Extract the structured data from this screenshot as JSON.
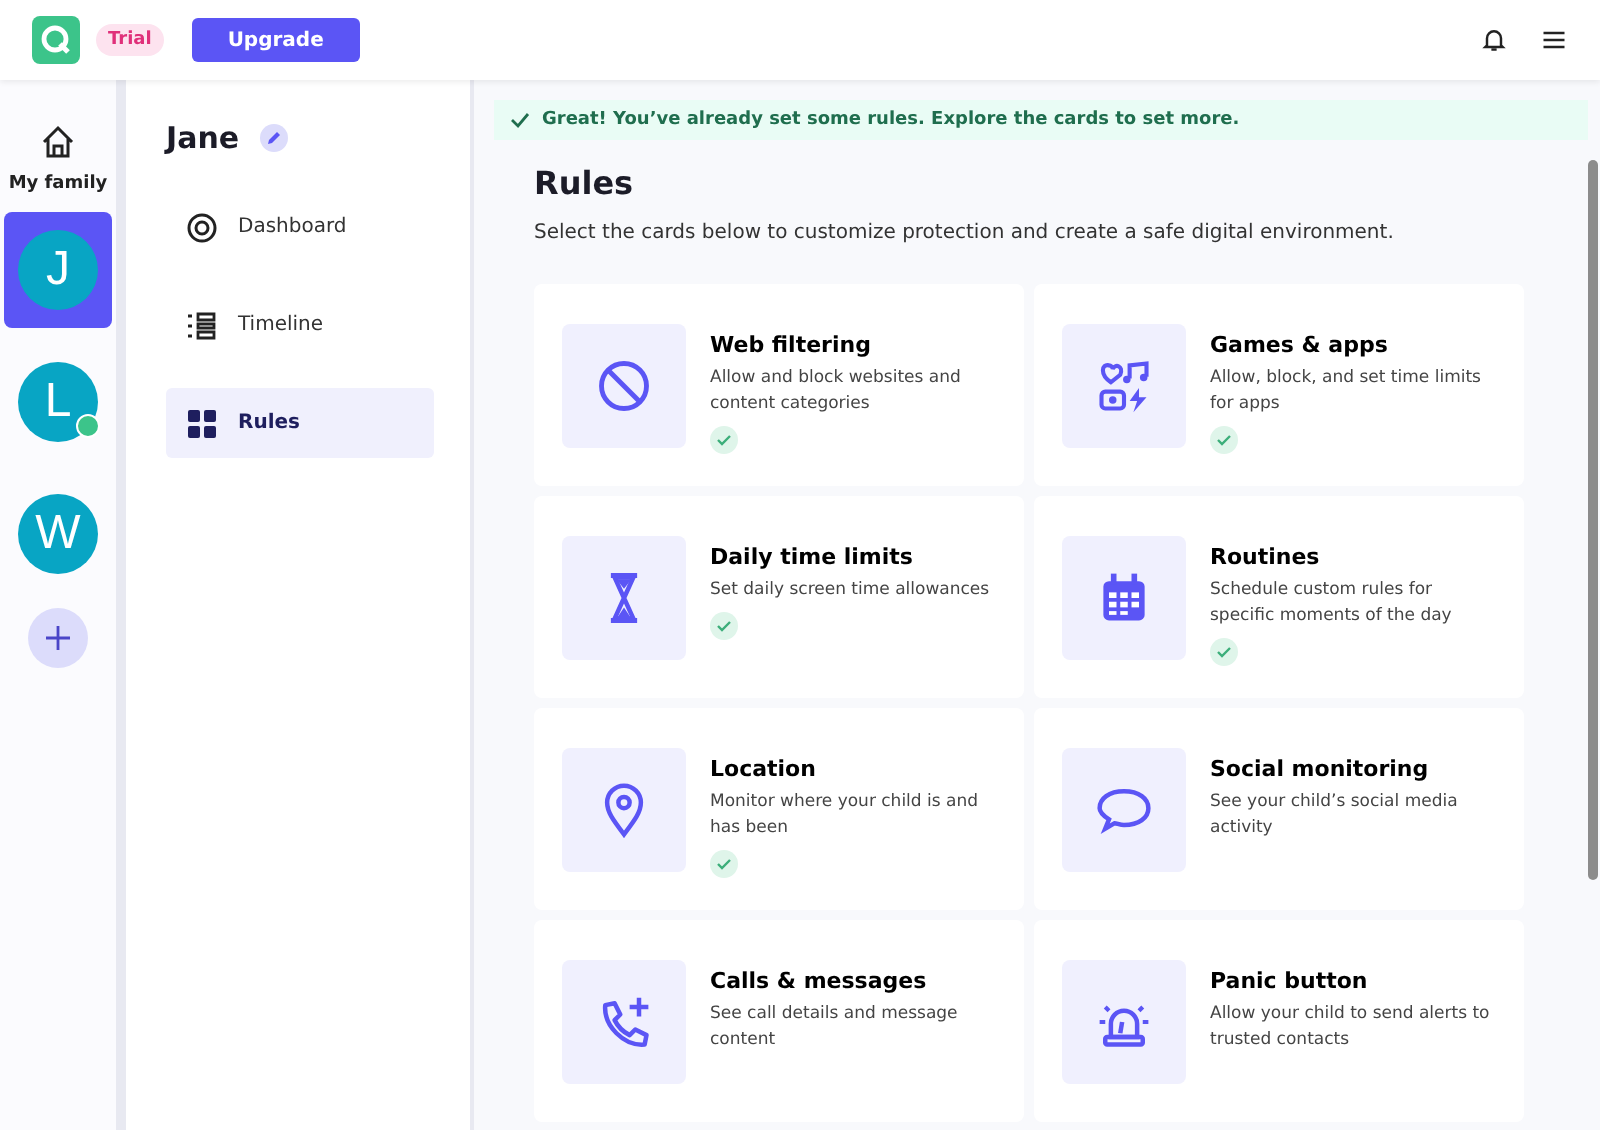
{
  "top_bar": {
    "plan_badge": "Trial",
    "upgrade_button": "Upgrade"
  },
  "rail": {
    "home": {
      "label": "My family"
    },
    "profiles": [
      {
        "initial": "J",
        "selected": true,
        "online": false
      },
      {
        "initial": "L",
        "selected": false,
        "online": true
      },
      {
        "initial": "W",
        "selected": false,
        "online": false
      }
    ]
  },
  "nav": {
    "child_name": "Jane",
    "items": [
      {
        "label": "Dashboard",
        "selected": false
      },
      {
        "label": "Timeline",
        "selected": false
      },
      {
        "label": "Rules",
        "selected": true
      }
    ]
  },
  "banner": "Great! You’ve already set some rules. Explore the cards to set more.",
  "page": {
    "title": "Rules",
    "subtitle": "Select the cards below to customize protection and create a safe digital environment."
  },
  "cards": [
    {
      "title": "Web filtering",
      "description": "Allow and block websites and content categories",
      "configured": true
    },
    {
      "title": "Games & apps",
      "description": "Allow, block, and set time limits for apps",
      "configured": true
    },
    {
      "title": "Daily time limits",
      "description": "Set daily screen time allowances",
      "configured": true
    },
    {
      "title": "Routines",
      "description": "Schedule custom rules for specific moments of the day",
      "configured": true
    },
    {
      "title": "Location",
      "description": "Monitor where your child is and has been",
      "configured": true
    },
    {
      "title": "Social monitoring",
      "description": "See your child’s social media activity",
      "configured": false
    },
    {
      "title": "Calls & messages",
      "description": "See call details and message content",
      "configured": false
    },
    {
      "title": "Panic button",
      "description": "Allow your child to send alerts to trusted contacts",
      "configured": false
    }
  ]
}
